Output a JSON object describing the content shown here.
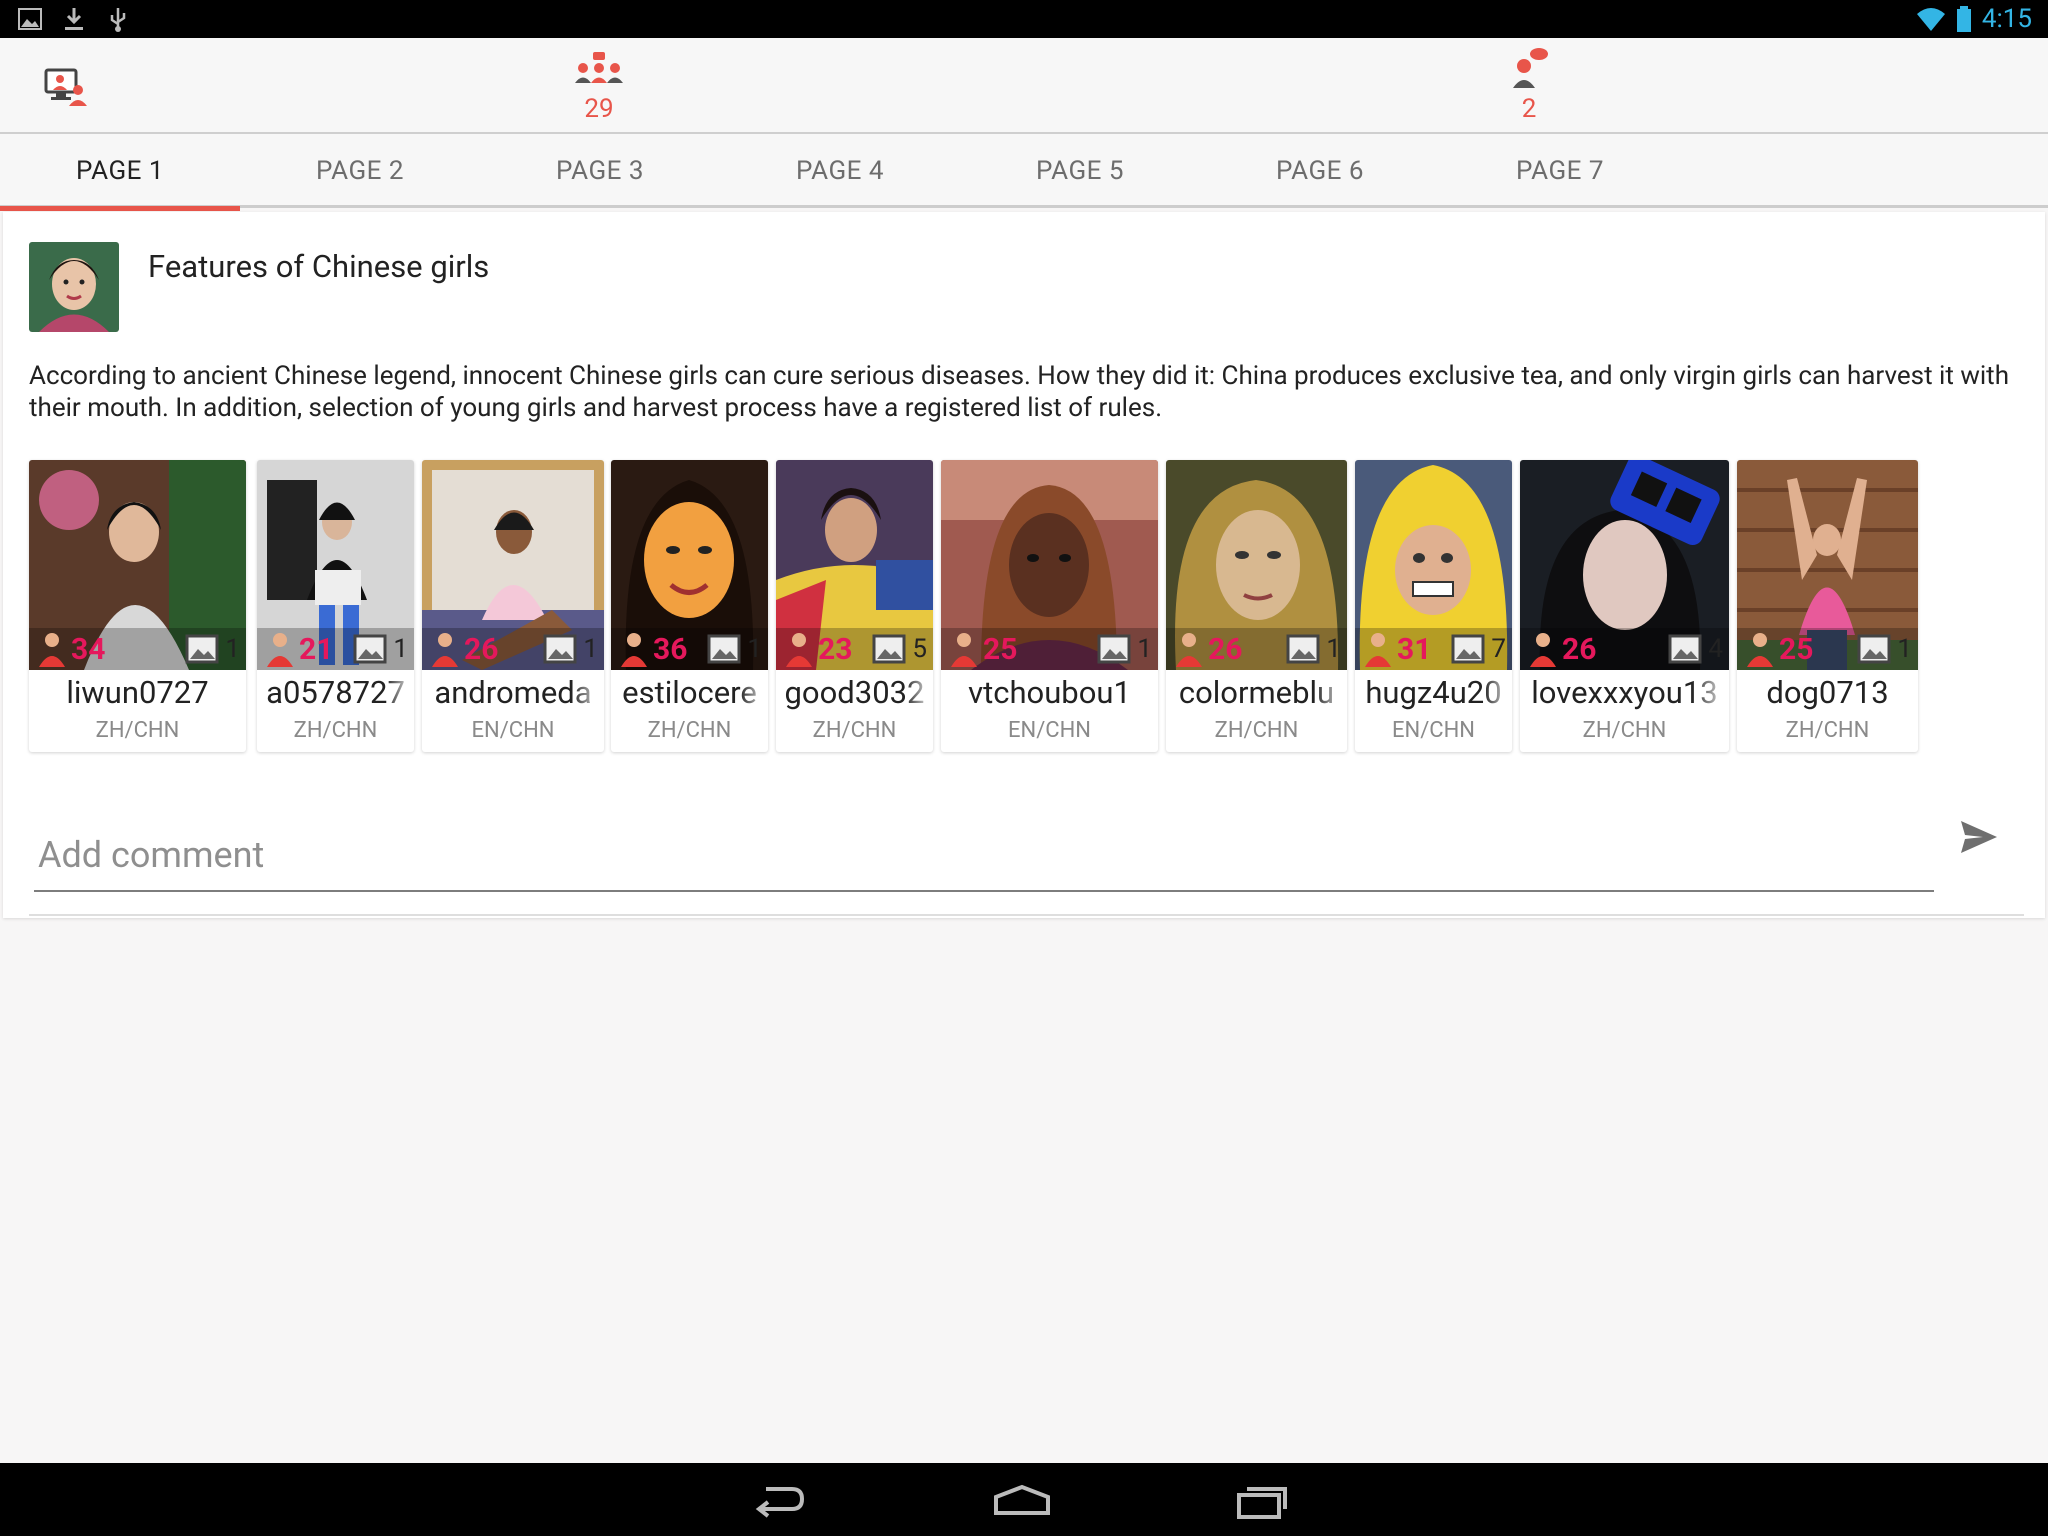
{
  "status_bar": {
    "time": "4:15",
    "left_icons": [
      "gallery-icon",
      "download-icon",
      "usb-icon"
    ],
    "right_icons": [
      "wifi-icon",
      "battery-icon"
    ]
  },
  "action_bar": {
    "left_icon": "video-chat-icon",
    "group_chat": {
      "icon": "group-chat-icon",
      "count": "29"
    },
    "messages": {
      "icon": "message-user-icon",
      "count": "2"
    }
  },
  "tabs": [
    {
      "label": "PAGE 1",
      "active": true
    },
    {
      "label": "PAGE 2",
      "active": false
    },
    {
      "label": "PAGE 3",
      "active": false
    },
    {
      "label": "PAGE 4",
      "active": false
    },
    {
      "label": "PAGE 5",
      "active": false
    },
    {
      "label": "PAGE 6",
      "active": false
    },
    {
      "label": "PAGE 7",
      "active": false
    }
  ],
  "post": {
    "title": "Features of Chinese girls",
    "body": "According to ancient Chinese legend, innocent Chinese girls can cure serious diseases. How they did it: China produces exclusive tea, and only virgin girls can harvest it with their mouth. In addition, selection of young girls and harvest process have a registered list of rules."
  },
  "users": [
    {
      "name": "liwun0727",
      "lang": "ZH/CHN",
      "age": "34",
      "photos": "1"
    },
    {
      "name": "a0578727",
      "lang": "ZH/CHN",
      "age": "21",
      "photos": "1"
    },
    {
      "name": "andromeda",
      "lang": "EN/CHN",
      "age": "26",
      "photos": "1"
    },
    {
      "name": "estilocere",
      "lang": "ZH/CHN",
      "age": "36",
      "photos": "1"
    },
    {
      "name": "good3032",
      "lang": "ZH/CHN",
      "age": "23",
      "photos": "5"
    },
    {
      "name": "vtchoubou1",
      "lang": "EN/CHN",
      "age": "25",
      "photos": "1"
    },
    {
      "name": "colormeblu",
      "lang": "ZH/CHN",
      "age": "26",
      "photos": "1"
    },
    {
      "name": "hugz4u20",
      "lang": "EN/CHN",
      "age": "31",
      "photos": "7"
    },
    {
      "name": "lovexxxyou13",
      "lang": "ZH/CHN",
      "age": "26",
      "photos": "4"
    },
    {
      "name": "dog0713",
      "lang": "ZH/CHN",
      "age": "25",
      "photos": "1"
    }
  ],
  "comment": {
    "placeholder": "Add comment",
    "send_icon": "send-icon"
  },
  "nav_bar": {
    "icons": [
      "back-icon",
      "home-icon",
      "recents-icon"
    ]
  },
  "colors": {
    "accent": "#e8554a",
    "age": "#e5185c",
    "status_blue": "#33b5e5"
  }
}
